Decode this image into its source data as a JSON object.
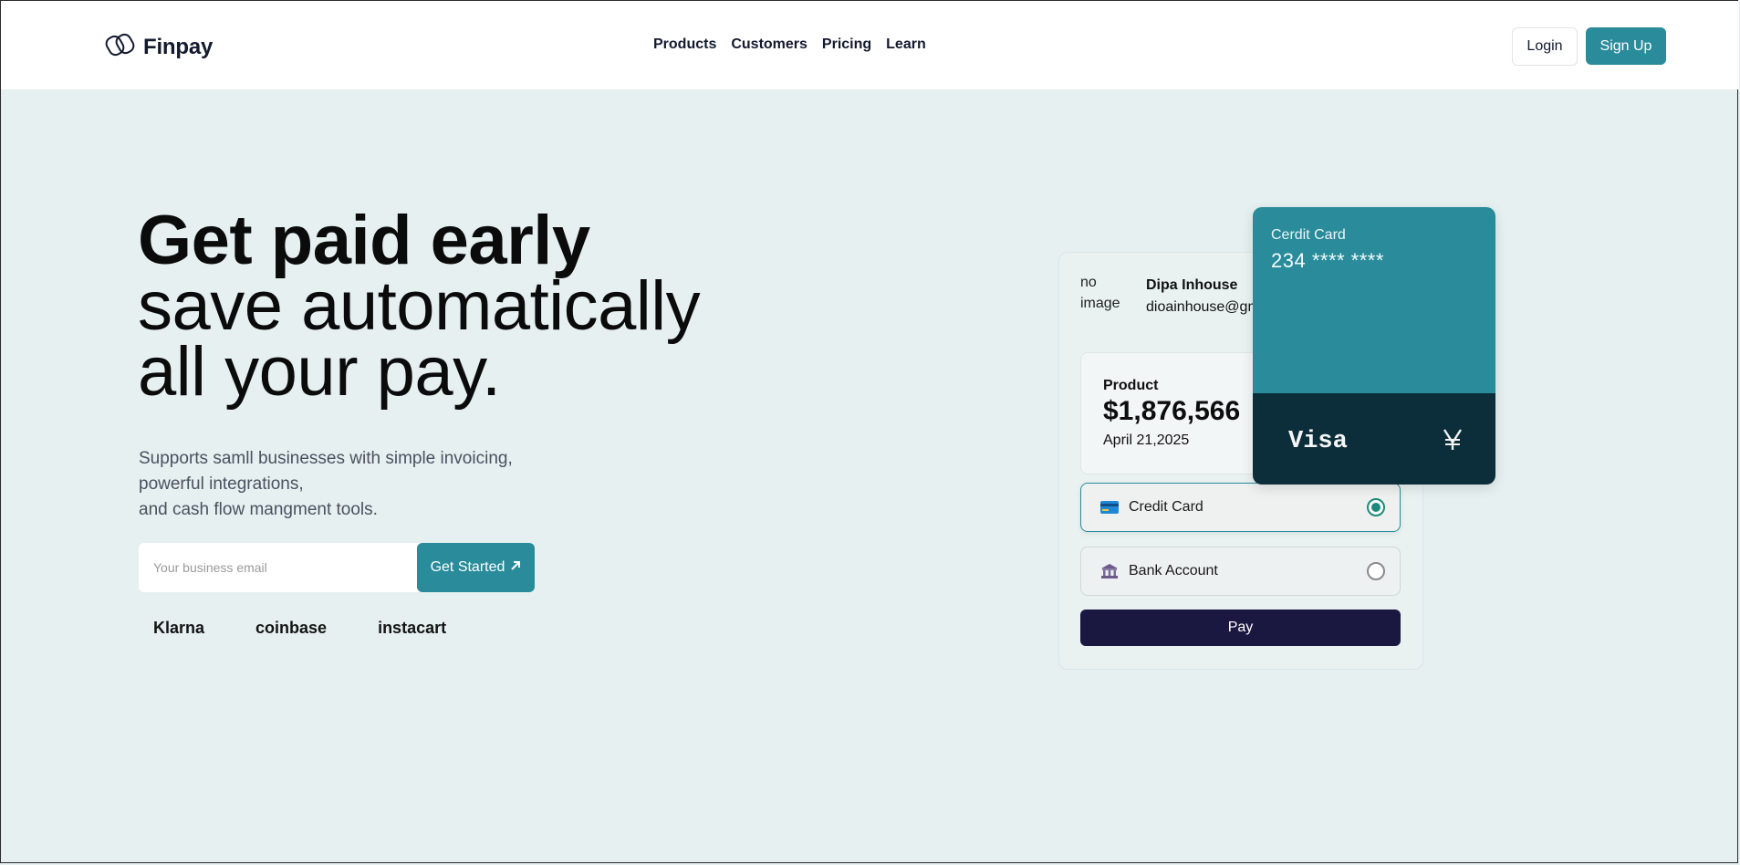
{
  "header": {
    "brand": "Finpay",
    "nav": [
      "Products",
      "Customers",
      "Pricing",
      "Learn"
    ],
    "login_label": "Login",
    "signup_label": "Sign Up"
  },
  "hero": {
    "headline_bold": "Get paid early",
    "headline_line2": "save automatically",
    "headline_line3": "all your pay.",
    "subtext": [
      "Supports samll businesses with simple invoicing,",
      "powerful integrations,",
      "and cash flow mangment tools."
    ],
    "email_placeholder": "Your business email",
    "cta_label": "Get Started",
    "brands": [
      "Klarna",
      "coinbase",
      "instacart"
    ]
  },
  "payment": {
    "avatar_alt": "no image",
    "user_name": "Dipa Inhouse",
    "user_email": "dioainhouse@gmail.com",
    "product_label": "Product",
    "product_amount": "$1,876,566",
    "product_date": "April 21,2025",
    "options": [
      {
        "label": "Credit Card",
        "icon": "credit-card-icon",
        "selected": true
      },
      {
        "label": "Bank Account",
        "icon": "bank-icon",
        "selected": false
      }
    ],
    "pay_label": "Pay"
  },
  "card": {
    "type": "Cerdit Card",
    "number": "234 **** ****",
    "brand": "Visa",
    "mark_icon": "yen-icon"
  },
  "colors": {
    "accent": "#2a8b9a",
    "dark_navy": "#1a1840",
    "card_dark": "#0b2e3a",
    "background": "#e6f0f0"
  }
}
